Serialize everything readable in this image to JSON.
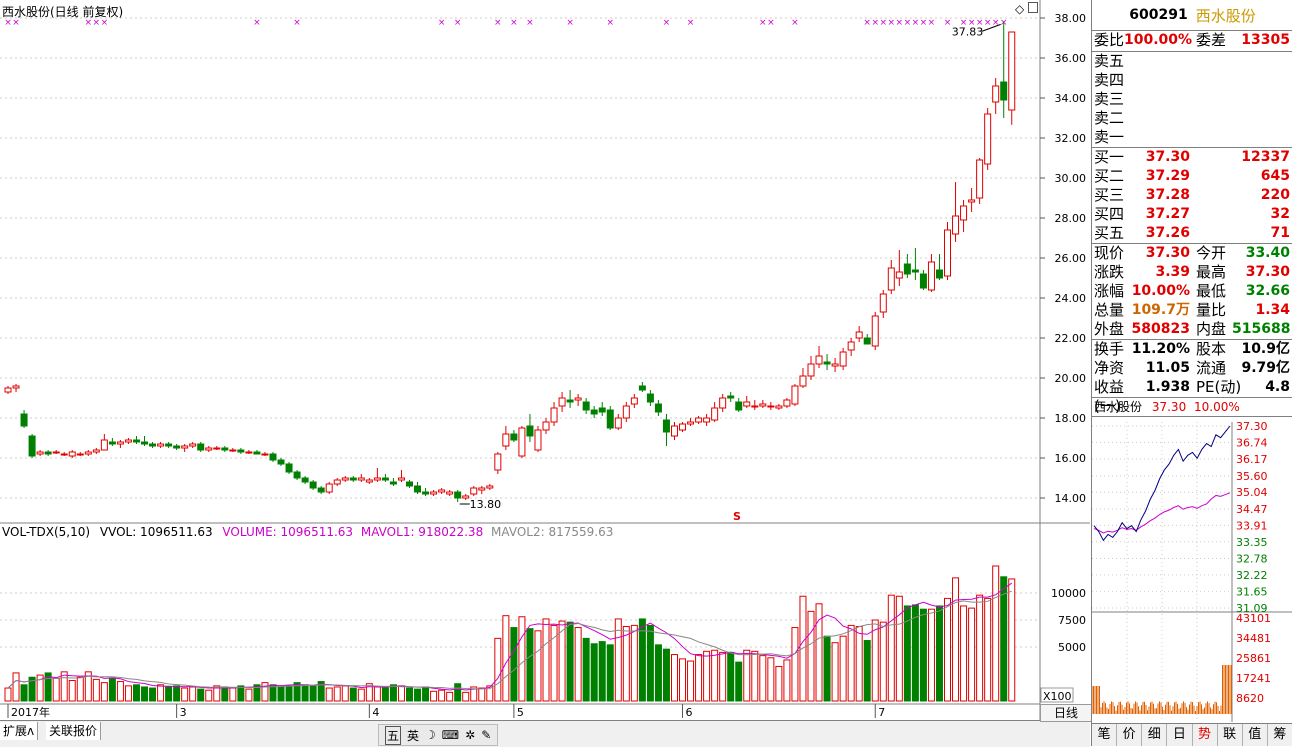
{
  "stock": {
    "code": "600291",
    "name": "西水股份",
    "title": "西水股份(日线 前复权)",
    "price": "37.30",
    "pct": "10.00%"
  },
  "colors": {
    "up": "#e00000",
    "down": "#008000",
    "ma1": "#cc00cc",
    "ma2": "#888888",
    "mark": "#cc00cc",
    "grid": "#cccccc"
  },
  "price_axis": [
    "38.00",
    "36.00",
    "34.00",
    "32.00",
    "30.00",
    "28.00",
    "26.00",
    "24.00",
    "22.00",
    "20.00",
    "18.00",
    "16.00",
    "14.00"
  ],
  "annotations": {
    "high": "37.83",
    "low": "13.80",
    "s_mark": "S"
  },
  "volume": {
    "header_title": "VOL-TDX(5,10)",
    "vvol": "VVOL: 1096511.63",
    "volume": "VOLUME: 1096511.63",
    "mavol1": "MAVOL1: 918022.38",
    "mavol2": "MAVOL2: 817559.63",
    "axis": [
      "10000",
      "7500",
      "5000"
    ],
    "unit": "X100"
  },
  "x_axis": [
    "2017年",
    "3",
    "4",
    "5",
    "6",
    "7"
  ],
  "bottom": {
    "ext": "扩展ʌ",
    "rel": "关联报价",
    "ime": [
      "五",
      "英",
      "☽",
      "⌨",
      "✲",
      "✎"
    ],
    "day": "日线"
  },
  "quote": {
    "weibi": {
      "l1": "委比",
      "v1": "100.00%",
      "l2": "委差",
      "v2": "13305"
    },
    "sell": [
      {
        "l": "卖五"
      },
      {
        "l": "卖四"
      },
      {
        "l": "卖三"
      },
      {
        "l": "卖二"
      },
      {
        "l": "卖一"
      }
    ],
    "buy": [
      {
        "l": "买一",
        "p": "37.30",
        "q": "12337"
      },
      {
        "l": "买二",
        "p": "37.29",
        "q": "645"
      },
      {
        "l": "买三",
        "p": "37.28",
        "q": "220"
      },
      {
        "l": "买四",
        "p": "37.27",
        "q": "32"
      },
      {
        "l": "买五",
        "p": "37.26",
        "q": "71"
      }
    ],
    "info": [
      [
        {
          "l": "现价",
          "v": "37.30",
          "c": "red"
        },
        {
          "l": "今开",
          "v": "33.40",
          "c": "grn"
        }
      ],
      [
        {
          "l": "涨跌",
          "v": "3.39",
          "c": "red"
        },
        {
          "l": "最高",
          "v": "37.30",
          "c": "red"
        }
      ],
      [
        {
          "l": "涨幅",
          "v": "10.00%",
          "c": "red"
        },
        {
          "l": "最低",
          "v": "32.66",
          "c": "grn"
        }
      ],
      [
        {
          "l": "总量",
          "v": "109.7万",
          "c": "org"
        },
        {
          "l": "量比",
          "v": "1.34",
          "c": "red"
        }
      ],
      [
        {
          "l": "外盘",
          "v": "580823",
          "c": "red"
        },
        {
          "l": "内盘",
          "v": "515688",
          "c": "grn"
        }
      ]
    ],
    "info2": [
      [
        {
          "l": "换手",
          "v": "11.20%",
          "c": ""
        },
        {
          "l": "股本",
          "v": "10.9亿",
          "c": ""
        }
      ],
      [
        {
          "l": "净资",
          "v": "11.05",
          "c": ""
        },
        {
          "l": "流通",
          "v": "9.79亿",
          "c": ""
        }
      ],
      [
        {
          "l": "收益(一)",
          "v": "1.938",
          "c": ""
        },
        {
          "l": "PE(动)",
          "v": "4.8",
          "c": ""
        }
      ]
    ]
  },
  "mini": {
    "title": "西水股份",
    "price": "37.30",
    "pct": "10.00%",
    "axis": [
      "37.30",
      "36.74",
      "36.17",
      "35.60",
      "35.04",
      "34.47",
      "33.91",
      "33.35",
      "32.78",
      "32.22",
      "31.65",
      "31.09"
    ],
    "vol_axis": [
      "43101",
      "34481",
      "25861",
      "17241",
      "8620"
    ]
  },
  "tabs": [
    "笔",
    "价",
    "细",
    "日",
    "势",
    "联",
    "值",
    "筹"
  ],
  "chart_data": {
    "type": "candlestick",
    "note_markers": "x",
    "candles": [
      [
        19.3,
        19.6,
        19.2,
        19.5
      ],
      [
        19.5,
        19.7,
        19.3,
        19.6
      ],
      [
        18.2,
        18.4,
        17.5,
        17.6
      ],
      [
        17.1,
        17.2,
        16.0,
        16.1
      ],
      [
        16.2,
        16.4,
        16.1,
        16.3
      ],
      [
        16.3,
        16.4,
        16.1,
        16.2
      ],
      [
        16.3,
        16.4,
        16.2,
        16.3
      ],
      [
        16.2,
        16.3,
        16.1,
        16.2
      ],
      [
        16.1,
        16.4,
        16.0,
        16.3
      ],
      [
        16.2,
        16.3,
        16.1,
        16.2
      ],
      [
        16.2,
        16.4,
        16.1,
        16.3
      ],
      [
        16.3,
        16.5,
        16.2,
        16.4
      ],
      [
        16.4,
        17.2,
        16.4,
        16.9
      ],
      [
        16.8,
        17.0,
        16.6,
        16.7
      ],
      [
        16.7,
        16.9,
        16.5,
        16.8
      ],
      [
        16.8,
        17.0,
        16.7,
        16.9
      ],
      [
        16.9,
        17.1,
        16.7,
        16.8
      ],
      [
        16.8,
        17.1,
        16.6,
        16.7
      ],
      [
        16.7,
        16.8,
        16.5,
        16.6
      ],
      [
        16.6,
        16.8,
        16.5,
        16.7
      ],
      [
        16.7,
        16.8,
        16.5,
        16.6
      ],
      [
        16.6,
        16.7,
        16.4,
        16.5
      ],
      [
        16.5,
        16.7,
        16.3,
        16.6
      ],
      [
        16.6,
        16.8,
        16.5,
        16.7
      ],
      [
        16.7,
        16.8,
        16.3,
        16.4
      ],
      [
        16.4,
        16.6,
        16.3,
        16.5
      ],
      [
        16.5,
        16.6,
        16.4,
        16.5
      ],
      [
        16.5,
        16.6,
        16.3,
        16.4
      ],
      [
        16.4,
        16.5,
        16.3,
        16.4
      ],
      [
        16.4,
        16.5,
        16.2,
        16.3
      ],
      [
        16.3,
        16.4,
        16.2,
        16.3
      ],
      [
        16.3,
        16.4,
        16.2,
        16.2
      ],
      [
        16.2,
        16.3,
        16.1,
        16.2
      ],
      [
        16.2,
        16.3,
        15.8,
        15.9
      ],
      [
        15.9,
        16.0,
        15.6,
        15.7
      ],
      [
        15.7,
        15.8,
        15.2,
        15.3
      ],
      [
        15.3,
        15.4,
        14.9,
        15.0
      ],
      [
        15.0,
        15.1,
        14.7,
        14.8
      ],
      [
        14.8,
        14.9,
        14.4,
        14.5
      ],
      [
        14.5,
        14.6,
        14.2,
        14.3
      ],
      [
        14.3,
        14.8,
        14.2,
        14.7
      ],
      [
        14.7,
        15.0,
        14.6,
        14.9
      ],
      [
        14.9,
        15.1,
        14.8,
        15.0
      ],
      [
        15.0,
        15.1,
        14.8,
        14.9
      ],
      [
        14.9,
        15.2,
        14.8,
        15.0
      ],
      [
        14.8,
        15.0,
        14.7,
        14.9
      ],
      [
        14.9,
        15.5,
        14.8,
        15.0
      ],
      [
        15.0,
        15.2,
        14.8,
        14.9
      ],
      [
        14.8,
        15.0,
        14.6,
        14.7
      ],
      [
        14.9,
        15.4,
        14.8,
        15.0
      ],
      [
        14.8,
        14.9,
        14.5,
        14.6
      ],
      [
        14.6,
        14.8,
        14.2,
        14.3
      ],
      [
        14.3,
        14.5,
        14.1,
        14.2
      ],
      [
        14.2,
        14.4,
        14.1,
        14.3
      ],
      [
        14.3,
        14.5,
        14.2,
        14.4
      ],
      [
        14.2,
        14.4,
        14.1,
        14.3
      ],
      [
        14.3,
        14.4,
        13.8,
        14.0
      ],
      [
        14.0,
        14.2,
        13.9,
        14.1
      ],
      [
        14.2,
        14.6,
        14.1,
        14.5
      ],
      [
        14.4,
        14.6,
        14.2,
        14.5
      ],
      [
        14.5,
        14.7,
        14.4,
        14.6
      ],
      [
        15.4,
        16.3,
        15.2,
        16.2
      ],
      [
        16.6,
        17.6,
        16.4,
        17.2
      ],
      [
        17.2,
        17.4,
        16.8,
        16.9
      ],
      [
        16.1,
        17.6,
        16.0,
        17.5
      ],
      [
        17.6,
        18.2,
        16.8,
        17.1
      ],
      [
        16.4,
        17.6,
        16.3,
        17.4
      ],
      [
        17.4,
        18.0,
        17.2,
        17.8
      ],
      [
        17.8,
        18.8,
        17.6,
        18.5
      ],
      [
        18.6,
        19.3,
        18.3,
        19.0
      ],
      [
        18.9,
        19.4,
        18.5,
        18.8
      ],
      [
        18.9,
        19.2,
        18.6,
        19.0
      ],
      [
        18.8,
        19.0,
        18.2,
        18.4
      ],
      [
        18.4,
        18.6,
        18.0,
        18.2
      ],
      [
        18.5,
        18.8,
        18.1,
        18.3
      ],
      [
        18.4,
        18.6,
        17.4,
        17.5
      ],
      [
        17.5,
        18.2,
        17.4,
        18.0
      ],
      [
        18.0,
        18.8,
        17.8,
        18.6
      ],
      [
        18.7,
        19.2,
        18.5,
        19.0
      ],
      [
        19.6,
        19.8,
        19.3,
        19.4
      ],
      [
        19.2,
        19.4,
        18.6,
        18.8
      ],
      [
        18.7,
        18.9,
        18.1,
        18.3
      ],
      [
        17.9,
        18.2,
        16.6,
        17.3
      ],
      [
        17.1,
        17.8,
        16.9,
        17.6
      ],
      [
        17.4,
        17.8,
        17.3,
        17.7
      ],
      [
        17.7,
        18.0,
        17.6,
        17.8
      ],
      [
        17.8,
        18.1,
        17.7,
        18.0
      ],
      [
        17.8,
        18.2,
        17.6,
        18.0
      ],
      [
        17.9,
        18.8,
        17.8,
        18.5
      ],
      [
        18.5,
        19.2,
        18.3,
        19.0
      ],
      [
        19.1,
        19.3,
        18.8,
        19.0
      ],
      [
        18.8,
        19.0,
        18.3,
        18.4
      ],
      [
        18.6,
        19.1,
        18.5,
        18.8
      ],
      [
        18.6,
        18.9,
        18.4,
        18.6
      ],
      [
        18.6,
        18.9,
        18.5,
        18.7
      ],
      [
        18.6,
        18.8,
        18.4,
        18.6
      ],
      [
        18.5,
        18.7,
        18.4,
        18.6
      ],
      [
        18.6,
        19.0,
        18.5,
        18.9
      ],
      [
        18.7,
        19.7,
        18.6,
        19.6
      ],
      [
        19.6,
        20.5,
        19.5,
        20.1
      ],
      [
        20.1,
        21.1,
        19.9,
        20.7
      ],
      [
        20.7,
        21.6,
        20.5,
        21.1
      ],
      [
        20.8,
        21.2,
        20.4,
        20.7
      ],
      [
        20.6,
        21.0,
        20.3,
        20.7
      ],
      [
        20.6,
        21.5,
        20.4,
        21.3
      ],
      [
        21.4,
        22.0,
        21.1,
        21.8
      ],
      [
        22.0,
        22.6,
        21.8,
        22.3
      ],
      [
        22.0,
        22.2,
        21.8,
        21.7
      ],
      [
        21.6,
        23.3,
        21.4,
        23.1
      ],
      [
        23.3,
        24.4,
        23.0,
        24.2
      ],
      [
        24.4,
        25.9,
        24.2,
        25.5
      ],
      [
        25.0,
        26.4,
        24.6,
        25.3
      ],
      [
        25.7,
        26.2,
        25.0,
        25.2
      ],
      [
        25.4,
        26.5,
        24.9,
        25.3
      ],
      [
        25.2,
        25.4,
        24.4,
        24.5
      ],
      [
        24.4,
        26.2,
        24.3,
        25.8
      ],
      [
        25.4,
        26.2,
        24.9,
        25.0
      ],
      [
        25.1,
        27.8,
        24.9,
        27.4
      ],
      [
        27.2,
        29.8,
        26.8,
        28.1
      ],
      [
        27.9,
        28.9,
        27.3,
        28.6
      ],
      [
        28.8,
        29.5,
        28.3,
        28.9
      ],
      [
        29.0,
        31.0,
        28.7,
        30.9
      ],
      [
        30.7,
        33.5,
        30.4,
        33.2
      ],
      [
        33.8,
        35.0,
        33.2,
        34.6
      ],
      [
        34.8,
        37.83,
        33.0,
        33.9
      ],
      [
        33.4,
        37.3,
        32.66,
        37.3
      ]
    ],
    "volumes_x100": [
      1200,
      2600,
      1500,
      2200,
      2400,
      2600,
      2100,
      2700,
      1900,
      2200,
      2700,
      2000,
      1700,
      2100,
      1800,
      1400,
      1500,
      1300,
      1200,
      1500,
      1300,
      1400,
      1200,
      1300,
      1100,
      1000,
      1400,
      1300,
      1200,
      1400,
      1100,
      1500,
      1700,
      1500,
      1300,
      1400,
      1700,
      1500,
      1400,
      1800,
      1200,
      1300,
      1400,
      1200,
      1100,
      1600,
      1300,
      1200,
      1500,
      1400,
      1200,
      1100,
      1300,
      900,
      1000,
      800,
      1600,
      800,
      1300,
      1200,
      1400,
      5800,
      7900,
      6800,
      7800,
      6700,
      6500,
      7600,
      7000,
      7400,
      7300,
      6800,
      5800,
      5300,
      5500,
      5200,
      7600,
      6900,
      7000,
      7600,
      7000,
      5200,
      4800,
      4300,
      3900,
      3700,
      4300,
      4600,
      4700,
      4500,
      4500,
      3600,
      4700,
      4600,
      4200,
      4000,
      3200,
      3800,
      6800,
      9700,
      8300,
      9000,
      6000,
      5400,
      6000,
      7000,
      6900,
      5600,
      7500,
      7300,
      9800,
      9700,
      8800,
      8900,
      8500,
      8500,
      8800,
      9500,
      11400,
      8800,
      8600,
      9800,
      9500,
      12500,
      11500,
      11300
    ],
    "ma_days": [
      5,
      10
    ]
  }
}
